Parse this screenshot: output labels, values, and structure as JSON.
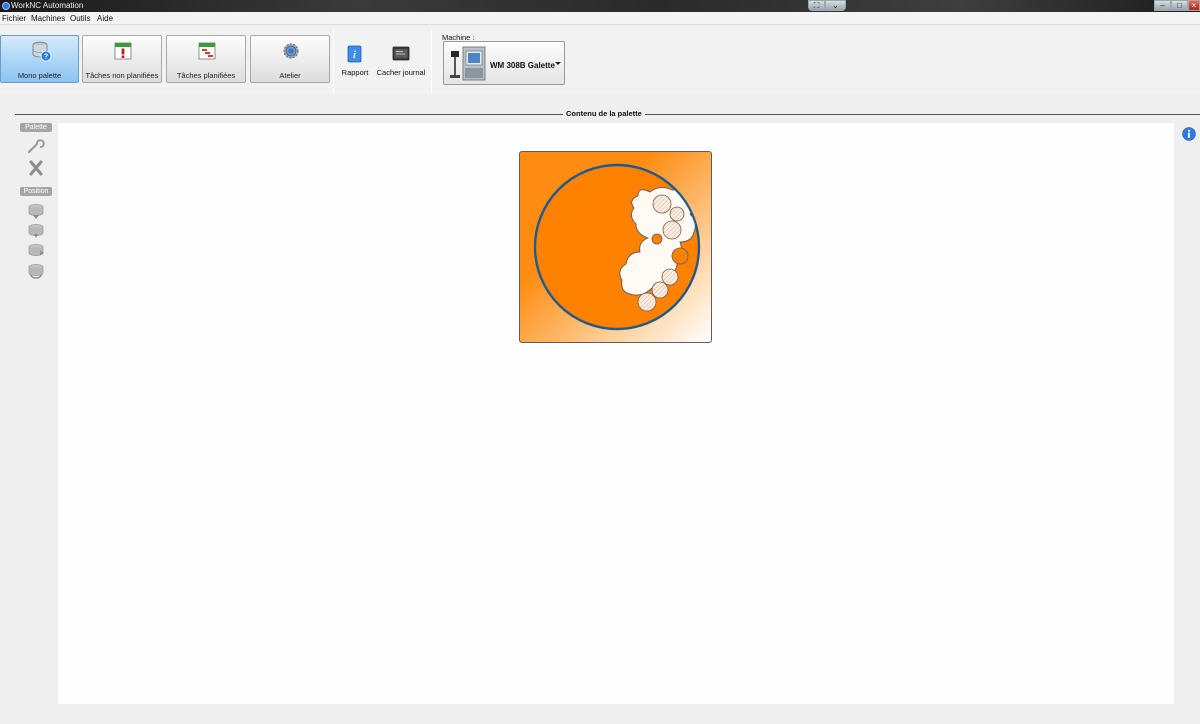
{
  "window": {
    "title": "WorkNC Automation"
  },
  "menu": {
    "items": [
      "Fichier",
      "Machines",
      "Outils",
      "Aide"
    ]
  },
  "toolbar": {
    "mode_buttons": [
      {
        "label": "Mono palette",
        "icon": "database-help-icon",
        "active": true
      },
      {
        "label": "Tâches non planifiées",
        "icon": "calendar-alert-icon",
        "active": false
      },
      {
        "label": "Tâches planifiées",
        "icon": "calendar-gantt-icon",
        "active": false
      },
      {
        "label": "Atelier",
        "icon": "gear-icon",
        "active": false
      }
    ],
    "report_label": "Rapport",
    "hide_log_label": "Cacher journal"
  },
  "machine": {
    "label": "Machine :",
    "selected": "WM 308B Galette"
  },
  "section": {
    "title": "Contenu de la palette"
  },
  "sidebar": {
    "palette_label": "Palette",
    "position_label": "Position",
    "palette_tools": [
      "wrench-icon",
      "delete-icon"
    ],
    "position_tools": [
      "layer-down-icon",
      "layer-down-alt-icon",
      "layer-side-icon",
      "layer-rotate-icon"
    ]
  },
  "colors": {
    "accent_blue": "#2c7be5",
    "palette_orange": "#ff8c12",
    "disc_border": "#1f5a8c",
    "active_button": "#a7d3f6"
  }
}
